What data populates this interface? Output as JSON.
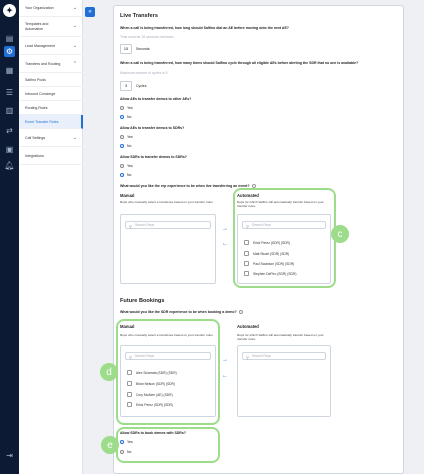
{
  "nav": {
    "items": [
      {
        "label": "Your Organization"
      },
      {
        "label": "Templates and Automation"
      },
      {
        "label": "Lead Management"
      },
      {
        "label": "Transfers and Routing"
      },
      {
        "label": "Salfino Pools"
      },
      {
        "label": "Inbound Concierge"
      },
      {
        "label": "Routing Rules"
      },
      {
        "label": "Event Transfer Rules"
      },
      {
        "label": "Call Settings"
      },
      {
        "label": "Integrations"
      }
    ]
  },
  "live_transfers": {
    "title": "Live Transfers",
    "q1": "When a call is being transferred, how long should Salfino dial an AE before moving onto the next AE?",
    "q1_hint": "Time must be 15 seconds minimum",
    "q1_value": "15",
    "q1_unit": "Seconds",
    "q2": "When a call is being transferred, how many times should Salfino cycle through all eligible AEs before alerting the SDR that no one is available?",
    "q2_hint": "Maximum number of cycles is 5",
    "q2_value": "3",
    "q2_unit": "Cycles",
    "q3": "Allow AEs to transfer demos to other AEs?",
    "q4": "Allow AEs to transfer demos to SDRs?",
    "q5": "Allow SDRs to transfer demos to SDRs?",
    "yes": "Yes",
    "no": "No",
    "q6": "What would you like the rep experience to be when live transferring an event?",
    "manual_title": "Manual",
    "manual_desc": "Reps who manually select a transferee based on your transfer rules.",
    "auto_title": "Automated",
    "auto_desc": "Reps for which Salfino will automatically transfer based on your transfer rules.",
    "search_placeholder": "Search Reps",
    "auto_reps": [
      "Erick Perez (SDR) (SDR)",
      "Matt Stuart (SDR) (SDR)",
      "Paul Swanson (SDR) (SDR)",
      "Stephen DePiro (SDR) (SDR)"
    ]
  },
  "future_bookings": {
    "title": "Future Bookings",
    "q1": "What would you like the SDR experience to be when booking a demo?",
    "manual_title": "Manual",
    "manual_desc": "Reps who manually select a transferee based on your transfer rules.",
    "auto_title": "Automated",
    "auto_desc": "Reps for which Salfino will automatically transfer based on your transfer rules.",
    "search_placeholder": "Search Reps",
    "manual_reps": [
      "Alex Sciarrata (SDR) (SDR)",
      "Brian Nelson (SDR) (SDR)",
      "Cory McAtee (AE) (SDR)",
      "Erick Perez (SDR) (SDR)"
    ],
    "q2": "Allow SDRs to book demos with SDRs?",
    "yes": "Yes",
    "no": "No"
  },
  "callouts": {
    "c": "c",
    "d": "d",
    "e": "e"
  },
  "colors": {
    "accent": "#1f6fd6",
    "highlight": "#9ddc8a",
    "rail": "#0c1b33"
  }
}
